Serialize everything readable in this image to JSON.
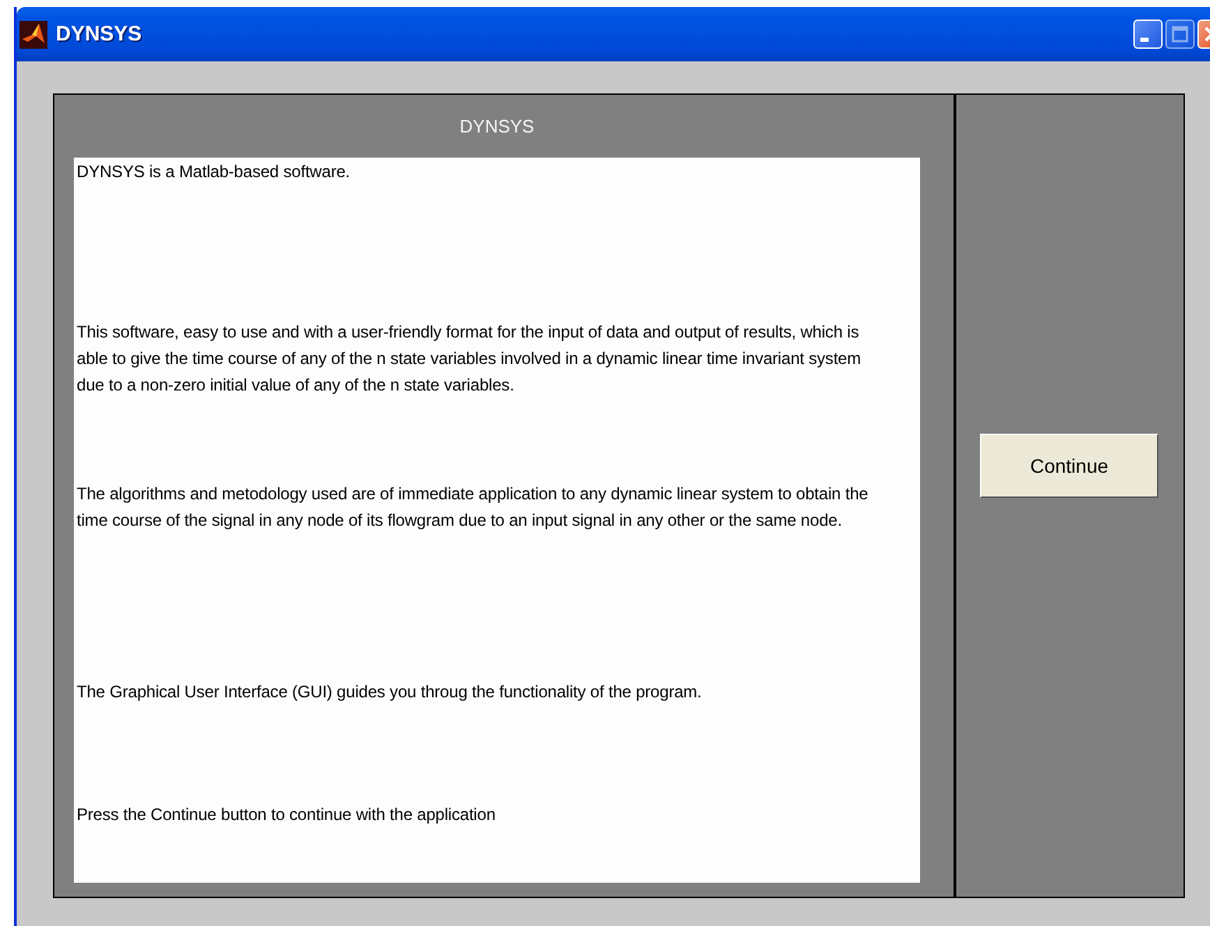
{
  "window": {
    "title": "DYNSYS"
  },
  "panel": {
    "title": "DYNSYS",
    "paragraphs": [
      "DYNSYS is a Matlab-based software.",
      "This software, easy to use and with a user-friendly format for the input of data and output of results, which is able to give the time course of any of the n state variables involved in a dynamic linear time invariant system due to a non-zero initial value of any of the n state variables.",
      "The algorithms and metodology used are of immediate application to any dynamic linear system to obtain the time course of the signal in any node of its flowgram due to an input signal in any other or the same node.",
      "The Graphical User Interface (GUI) guides you throug the functionality of the program.",
      "Press the Continue button to continue with the application"
    ]
  },
  "buttons": [
    "Continue"
  ]
}
